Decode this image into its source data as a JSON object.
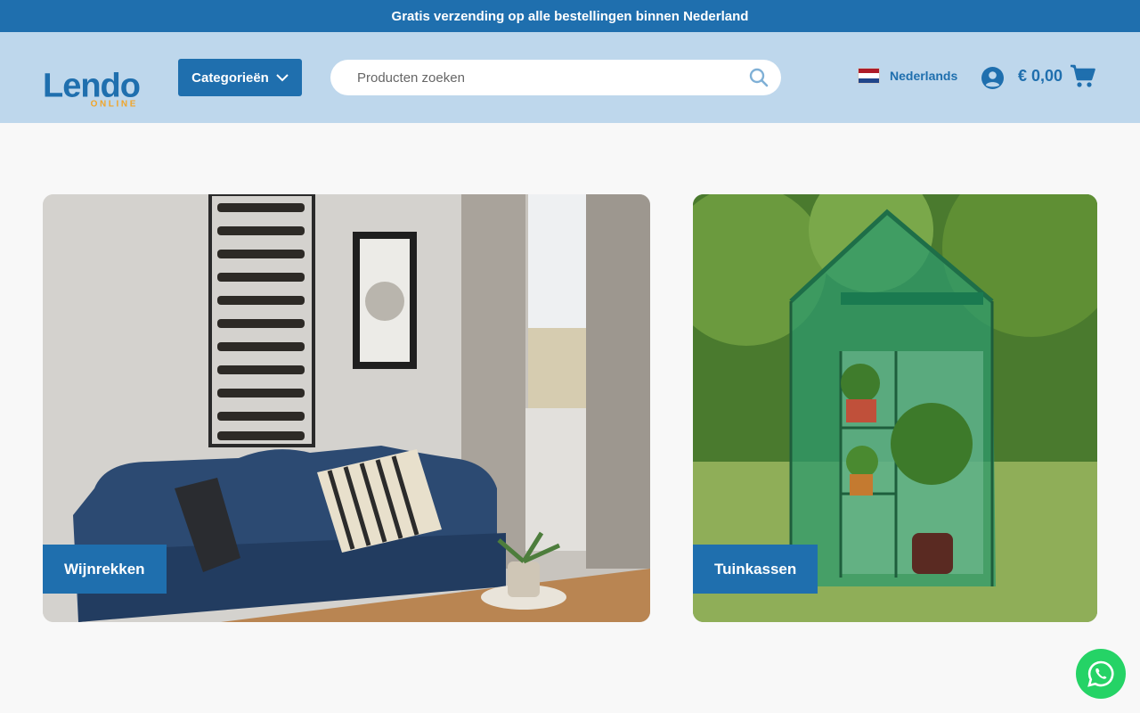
{
  "announcement": "Gratis verzending op alle bestellingen binnen Nederland",
  "logo": {
    "main": "Lendo",
    "sub": "ONLINE"
  },
  "header": {
    "categories_label": "Categorieën",
    "search_placeholder": "Producten zoeken",
    "language": "Nederlands",
    "cart_total": "€ 0,00"
  },
  "cards": [
    {
      "label": "Wijnrekken"
    },
    {
      "label": "Tuinkassen"
    }
  ],
  "colors": {
    "primary": "#1f6fae",
    "header_bg": "#bed7ec",
    "accent": "#f0a52b",
    "whatsapp": "#25d366"
  },
  "icons": [
    "chevron-down-icon",
    "search-icon",
    "netherlands-flag-icon",
    "user-icon",
    "cart-icon",
    "whatsapp-icon"
  ]
}
